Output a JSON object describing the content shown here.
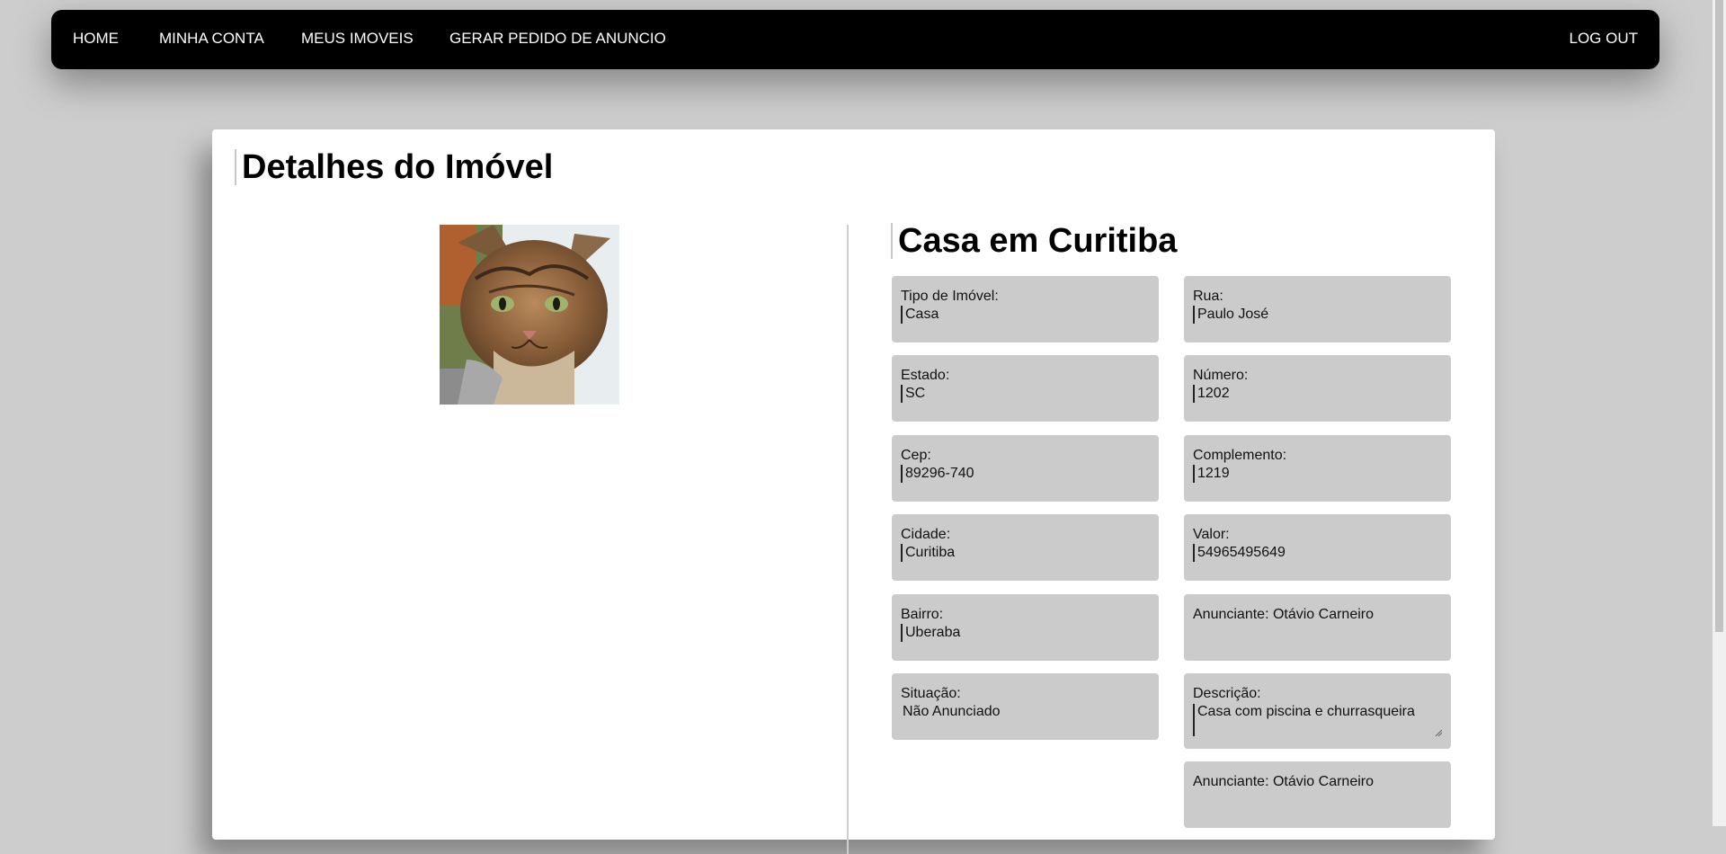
{
  "nav": {
    "home": "HOME",
    "account": "MINHA CONTA",
    "my_properties": "MEUS IMOVEIS",
    "generate_ad": "GERAR PEDIDO DE ANUNCIO",
    "logout": "LOG OUT"
  },
  "page": {
    "title": "Detalhes do Imóvel",
    "property_name": "Casa em Curitiba",
    "photo_icon": "cat-photo"
  },
  "fields": {
    "tipo": {
      "label": "Tipo de Imóvel:",
      "value": "Casa"
    },
    "rua": {
      "label": "Rua:",
      "value": "Paulo José"
    },
    "estado": {
      "label": "Estado:",
      "value": "SC"
    },
    "numero": {
      "label": "Número:",
      "value": "1202"
    },
    "cep": {
      "label": "Cep:",
      "value": "89296-740"
    },
    "complemento": {
      "label": "Complemento:",
      "value": "1219"
    },
    "cidade": {
      "label": "Cidade:",
      "value": "Curitiba"
    },
    "valor": {
      "label": "Valor:",
      "value": "54965495649"
    },
    "bairro": {
      "label": "Bairro:",
      "value": "Uberaba"
    },
    "anunciante1": {
      "label": "Anunciante: Otávio Carneiro"
    },
    "situacao": {
      "label": "Situação:",
      "value": "Não Anunciado"
    },
    "descricao": {
      "label": "Descrição:",
      "value": "Casa com piscina e churrasqueira"
    },
    "anunciante2": {
      "label": "Anunciante: Otávio Carneiro"
    }
  },
  "colors": {
    "navbar": "#000000",
    "background": "#cdcdcd",
    "field": "#cbcbcb",
    "card": "#ffffff"
  }
}
